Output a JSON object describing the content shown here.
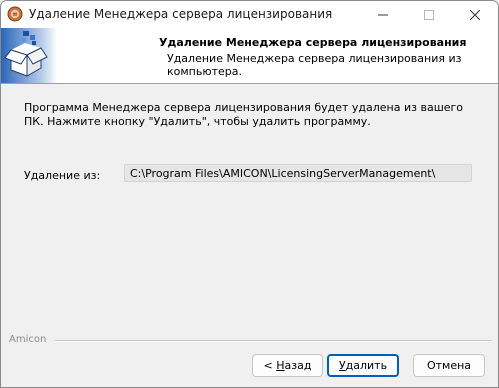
{
  "window": {
    "title": "Удаление Менеджера сервера лицензирования",
    "controls": {
      "minimize": "minimize-icon",
      "maximize": "maximize-icon",
      "close": "close-icon"
    }
  },
  "header": {
    "title": "Удаление Менеджера сервера лицензирования",
    "subtitle": "Удаление Менеджера сервера лицензирования из компьютера."
  },
  "body": {
    "message": "Программа Менеджера сервера лицензирования будет удалена из вашего ПК. Нажмите кнопку \"Удалить\", чтобы удалить программу.",
    "from_label": "Удаление из:",
    "path": "C:\\Program Files\\AMICON\\LicensingServerManagement\\"
  },
  "footer": {
    "brand": "Amicon",
    "back": {
      "prefix": "< ",
      "mnemonic": "Н",
      "rest": "азад"
    },
    "uninstall": {
      "mnemonic": "У",
      "rest": "далить"
    },
    "cancel": "Отмена"
  },
  "colors": {
    "accent": "#005fb8",
    "icon_blue": "#2b66b8"
  }
}
